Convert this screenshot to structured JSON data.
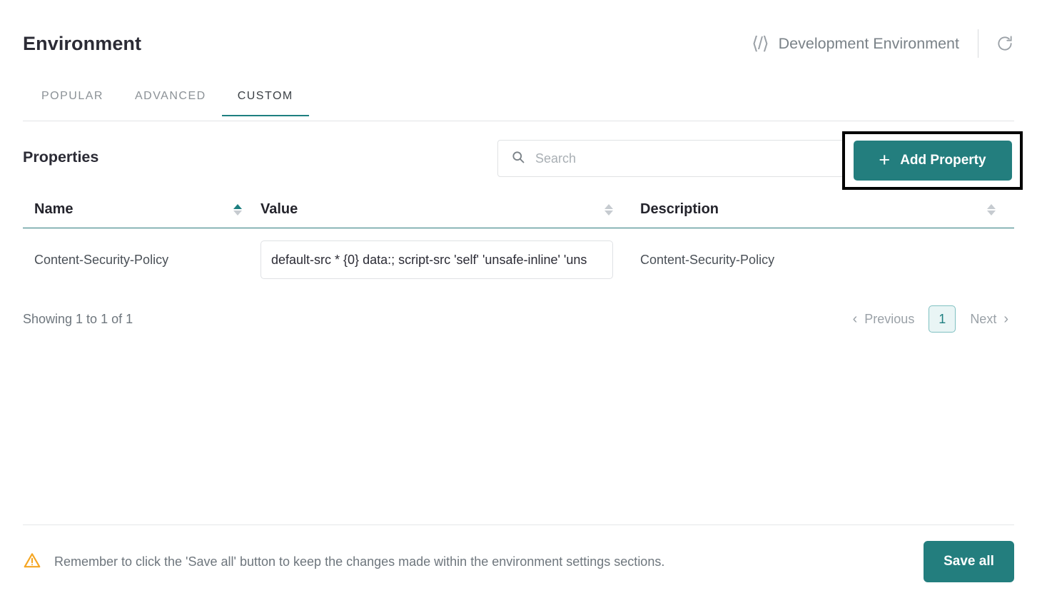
{
  "header": {
    "title": "Environment",
    "code_icon": "code-brackets-icon",
    "environment_name": "Development Environment",
    "refresh_icon": "refresh-icon"
  },
  "tabs": [
    {
      "label": "POPULAR",
      "active": false
    },
    {
      "label": "ADVANCED",
      "active": false
    },
    {
      "label": "CUSTOM",
      "active": true
    }
  ],
  "toolbar": {
    "heading": "Properties",
    "search_placeholder": "Search",
    "search_value": "",
    "search_icon": "search-icon",
    "add_button_label": "Add Property",
    "add_button_icon": "plus-icon",
    "add_button_highlighted": true
  },
  "table": {
    "columns": [
      {
        "label": "Name",
        "sort": "asc"
      },
      {
        "label": "Value",
        "sort": "none"
      },
      {
        "label": "Description",
        "sort": "none"
      }
    ],
    "rows": [
      {
        "name": "Content-Security-Policy",
        "value": "default-src * {0} data:; script-src 'self' 'unsafe-inline' 'uns",
        "description": "Content-Security-Policy"
      }
    ]
  },
  "pagination": {
    "showing": "Showing 1 to 1 of 1",
    "previous_label": "Previous",
    "next_label": "Next",
    "current_page": "1",
    "prev_icon": "chevron-left-icon",
    "next_icon": "chevron-right-icon"
  },
  "footer": {
    "warning_icon": "warning-triangle-icon",
    "message": "Remember to click the 'Save all' button to keep the changes made within the environment settings sections.",
    "save_label": "Save all"
  },
  "colors": {
    "accent_teal": "#237e7e",
    "tab_underline": "#1e7f80",
    "warning_orange": "#f5a623",
    "highlight_box": "#000000"
  }
}
